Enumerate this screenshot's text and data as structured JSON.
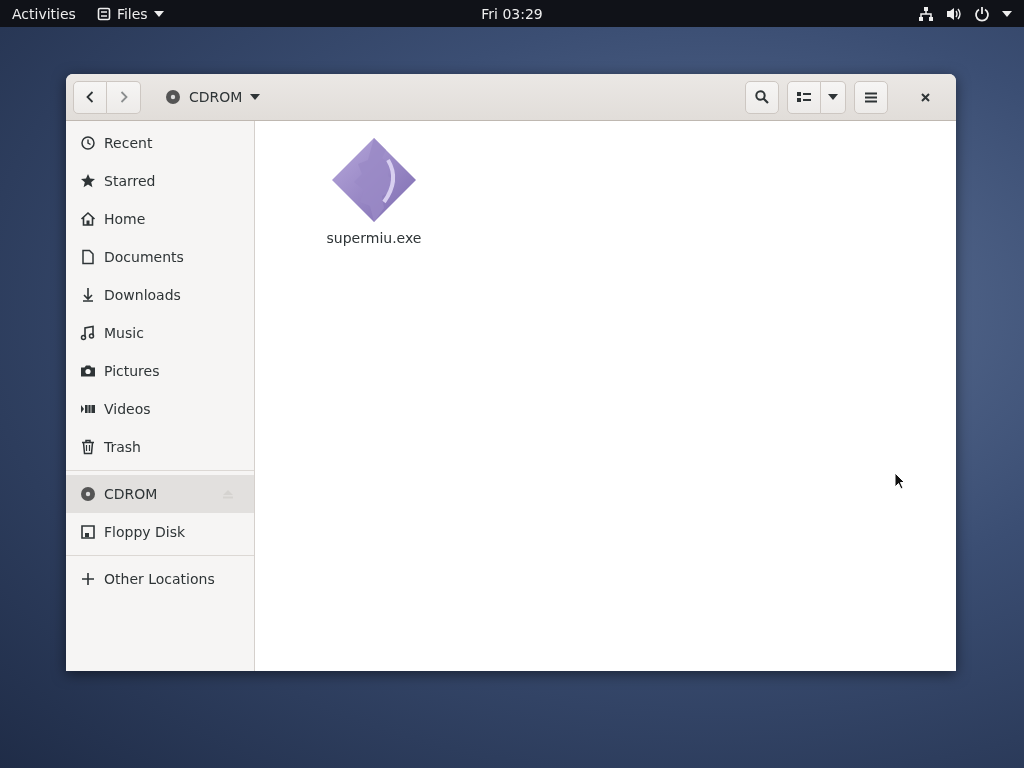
{
  "top_bar": {
    "activities": "Activities",
    "app_menu": "Files",
    "clock": "Fri 03:29"
  },
  "window": {
    "location": "CDROM"
  },
  "sidebar": {
    "sections": [
      {
        "items": [
          {
            "label": "Recent",
            "selected": false
          },
          {
            "label": "Starred",
            "selected": false
          },
          {
            "label": "Home",
            "selected": false
          },
          {
            "label": "Documents",
            "selected": false
          },
          {
            "label": "Downloads",
            "selected": false
          },
          {
            "label": "Music",
            "selected": false
          },
          {
            "label": "Pictures",
            "selected": false
          },
          {
            "label": "Videos",
            "selected": false
          },
          {
            "label": "Trash",
            "selected": false
          }
        ]
      },
      {
        "items": [
          {
            "label": "CDROM",
            "selected": true,
            "ejectable": true
          },
          {
            "label": "Floppy Disk",
            "selected": false,
            "ejectable": false
          }
        ]
      },
      {
        "items": [
          {
            "label": "Other Locations",
            "selected": false
          }
        ]
      }
    ]
  },
  "files": [
    {
      "name": "supermiu.exe"
    }
  ]
}
